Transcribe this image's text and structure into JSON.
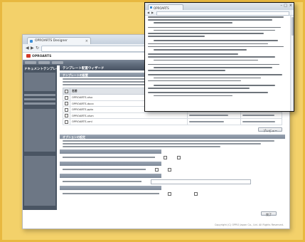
{
  "main_window": {
    "tab_title": "OPROARTS Designer",
    "app_logo": "OPROARTS",
    "sidebar_title": "ドキュメントテンプレート",
    "wizard_title": "テンプレート配置ウィザード",
    "sections": {
      "template_files": "テンプレートの配置",
      "options": "オプションの設定"
    },
    "table": {
      "headers": [
        "",
        "名前",
        "配置先",
        "説明"
      ],
      "rows": [
        [
          "",
          "OPROARTS.xlsx",
          "",
          ""
        ],
        [
          "",
          "OPROARTS.docx",
          "",
          ""
        ],
        [
          "",
          "OPROARTS.pptx",
          "",
          ""
        ],
        [
          "",
          "OPROARTS.xlsm",
          "",
          ""
        ],
        [
          "",
          "OPROARTS.xml",
          "",
          ""
        ]
      ]
    },
    "preview_button": "プレビュー",
    "finish_button": "完了",
    "copyright": "Copyright (C) OPRO Japan Co., Ltd. All Rights Reserved."
  },
  "popup_window": {
    "tab_title": "OPROARTS"
  },
  "colors": {
    "background": "#f3d16a",
    "sidebar": "#4a5563",
    "header_bar": "#475262"
  }
}
